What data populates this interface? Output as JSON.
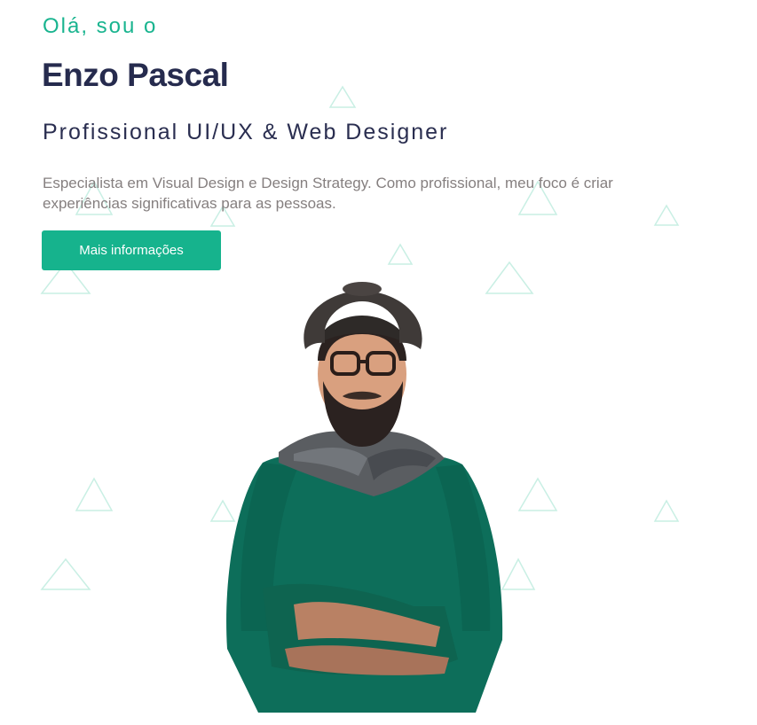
{
  "hero": {
    "greeting": "Olá, sou o",
    "name": "Enzo Pascal",
    "role": "Profissional UI/UX & Web Designer",
    "description": "Especialista em Visual Design e Design Strategy. Como profissional, meu foco é criar experiências significativas para as pessoas.",
    "cta_label": "Mais informações"
  },
  "colors": {
    "accent": "#16b38d",
    "heading": "#262b4e",
    "body_text": "#857f7f",
    "triangle_pattern": "#c9efe4",
    "sweater": "#0d6e5a",
    "hat": "#3f3a38",
    "scarf": "#5a5d61"
  },
  "icons": {
    "background_pattern": "triangle-outline-icon"
  },
  "portrait": {
    "subject": "portrait-photo"
  }
}
